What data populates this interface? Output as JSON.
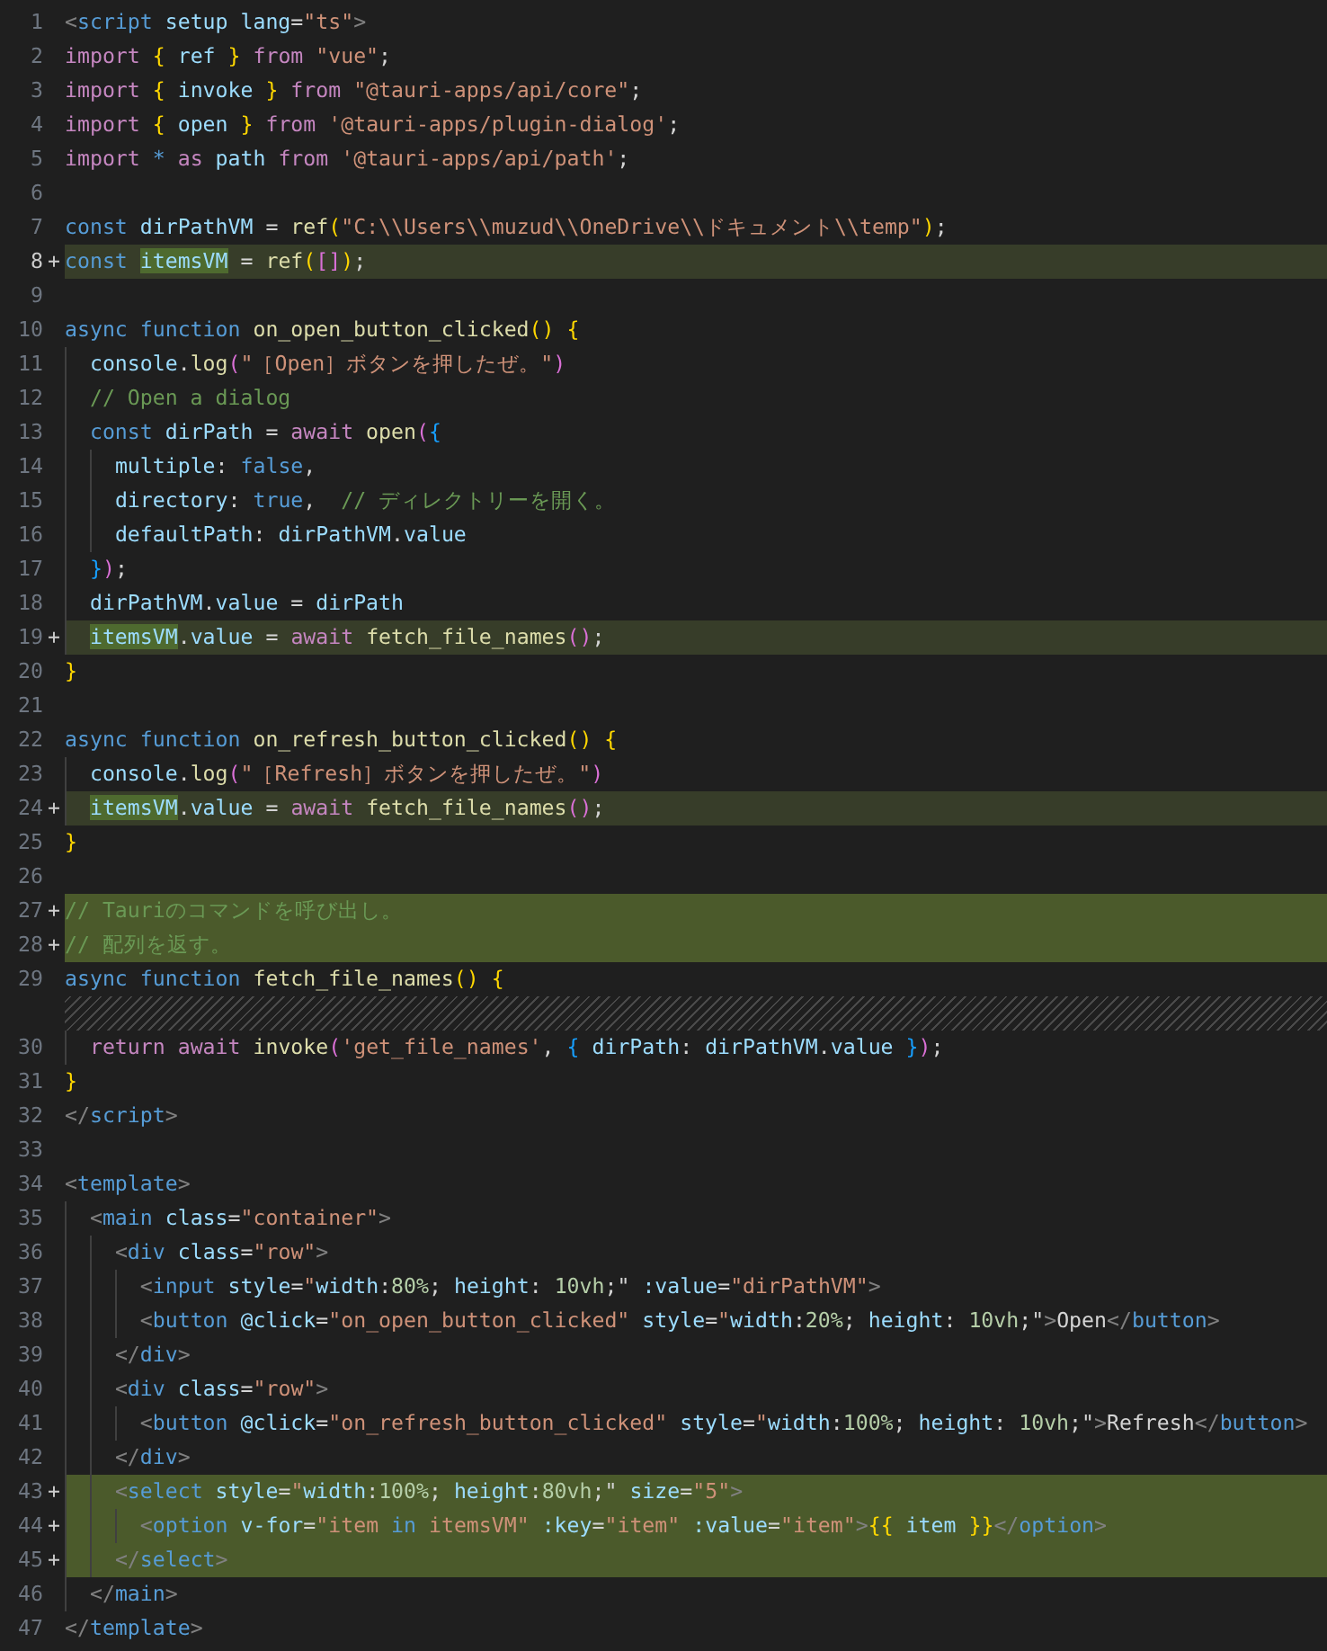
{
  "editor": {
    "lines": [
      {
        "kind": "context",
        "number": "1",
        "current": false,
        "tokens": [
          {
            "text": "<",
            "kind": "tagpunct"
          },
          {
            "text": "script",
            "kind": "tag"
          },
          {
            "text": " setup lang",
            "kind": "attribute"
          },
          {
            "text": "=",
            "kind": "plain"
          },
          {
            "text": "\"ts\"",
            "kind": "string"
          },
          {
            "text": ">",
            "kind": "tagpunct"
          }
        ]
      },
      {
        "kind": "context",
        "number": "2",
        "current": false,
        "tokens": [
          {
            "text": "import ",
            "kind": "keyword"
          },
          {
            "text": "{",
            "kind": "bracket1"
          },
          {
            "text": " ref ",
            "kind": "variable"
          },
          {
            "text": "}",
            "kind": "bracket1"
          },
          {
            "text": " from ",
            "kind": "keyword"
          },
          {
            "text": "\"vue\"",
            "kind": "string"
          },
          {
            "text": ";",
            "kind": "plain"
          }
        ]
      },
      {
        "kind": "context",
        "number": "3",
        "current": false,
        "tokens": [
          {
            "text": "import ",
            "kind": "keyword"
          },
          {
            "text": "{",
            "kind": "bracket1"
          },
          {
            "text": " invoke ",
            "kind": "variable"
          },
          {
            "text": "}",
            "kind": "bracket1"
          },
          {
            "text": " from ",
            "kind": "keyword"
          },
          {
            "text": "\"@tauri-apps/api/core\"",
            "kind": "string"
          },
          {
            "text": ";",
            "kind": "plain"
          }
        ]
      },
      {
        "kind": "context",
        "number": "4",
        "current": false,
        "tokens": [
          {
            "text": "import ",
            "kind": "keyword"
          },
          {
            "text": "{",
            "kind": "bracket1"
          },
          {
            "text": " open ",
            "kind": "variable"
          },
          {
            "text": "}",
            "kind": "bracket1"
          },
          {
            "text": " from ",
            "kind": "keyword"
          },
          {
            "text": "'@tauri-apps/plugin-dialog'",
            "kind": "string"
          },
          {
            "text": ";",
            "kind": "plain"
          }
        ]
      },
      {
        "kind": "context",
        "number": "5",
        "current": false,
        "tokens": [
          {
            "text": "import ",
            "kind": "keyword"
          },
          {
            "text": "*",
            "kind": "storage"
          },
          {
            "text": " as",
            "kind": "keyword"
          },
          {
            "text": " path",
            "kind": "variable"
          },
          {
            "text": " from ",
            "kind": "keyword"
          },
          {
            "text": "'@tauri-apps/api/path'",
            "kind": "string"
          },
          {
            "text": ";",
            "kind": "plain"
          }
        ]
      },
      {
        "kind": "context",
        "number": "6",
        "current": false
      },
      {
        "kind": "context",
        "number": "7",
        "current": false,
        "tokens": [
          {
            "text": "const",
            "kind": "storage"
          },
          {
            "text": " dirPathVM",
            "kind": "variable"
          },
          {
            "text": " = ",
            "kind": "plain"
          },
          {
            "text": "ref",
            "kind": "function"
          },
          {
            "text": "(",
            "kind": "bracket1"
          },
          {
            "text": "\"C:\\\\Users\\\\muzud\\\\OneDrive\\\\ドキュメント\\\\temp\"",
            "kind": "string"
          },
          {
            "text": ")",
            "kind": "bracket1"
          },
          {
            "text": ";",
            "kind": "plain"
          }
        ]
      },
      {
        "kind": "modified",
        "number": "8",
        "marker": "+",
        "current": true,
        "tokens": [
          {
            "text": "const ",
            "kind": "storage"
          },
          {
            "text": "itemsVM",
            "kind": "variable",
            "changed": true
          },
          {
            "text": " = ",
            "kind": "plain"
          },
          {
            "text": "ref",
            "kind": "function"
          },
          {
            "text": "(",
            "kind": "bracket1"
          },
          {
            "text": "[]",
            "kind": "bracket2"
          },
          {
            "text": ")",
            "kind": "bracket1"
          },
          {
            "text": ";",
            "kind": "plain"
          }
        ]
      },
      {
        "kind": "context",
        "number": "9",
        "current": false
      },
      {
        "kind": "context",
        "number": "10",
        "current": false,
        "tokens": [
          {
            "text": "async",
            "kind": "storage"
          },
          {
            "text": " function",
            "kind": "storage"
          },
          {
            "text": " on_open_button_clicked",
            "kind": "function"
          },
          {
            "text": "() ",
            "kind": "bracket1"
          },
          {
            "text": "{",
            "kind": "bracket1"
          }
        ]
      },
      {
        "kind": "context",
        "number": "11",
        "current": false,
        "tokens": [
          {
            "text": "  console",
            "kind": "variable"
          },
          {
            "text": ".",
            "kind": "plain"
          },
          {
            "text": "log",
            "kind": "function"
          },
          {
            "text": "(",
            "kind": "bracket2"
          },
          {
            "text": "\"［Open］ボタンを押したぜ。\"",
            "kind": "string"
          },
          {
            "text": ")",
            "kind": "bracket2"
          }
        ]
      },
      {
        "kind": "context",
        "number": "12",
        "current": false,
        "tokens": [
          {
            "text": "  // Open a dialog",
            "kind": "comment"
          }
        ]
      },
      {
        "kind": "context",
        "number": "13",
        "current": false,
        "tokens": [
          {
            "text": "  const",
            "kind": "storage"
          },
          {
            "text": " dirPath",
            "kind": "variable"
          },
          {
            "text": " = ",
            "kind": "plain"
          },
          {
            "text": "await",
            "kind": "keyword"
          },
          {
            "text": " open",
            "kind": "function"
          },
          {
            "text": "(",
            "kind": "bracket2"
          },
          {
            "text": "{",
            "kind": "bracket3"
          }
        ]
      },
      {
        "kind": "context",
        "number": "14",
        "current": false,
        "tokens": [
          {
            "text": "    multiple",
            "kind": "variable"
          },
          {
            "text": ": ",
            "kind": "plain"
          },
          {
            "text": "false",
            "kind": "storage"
          },
          {
            "text": ",",
            "kind": "plain"
          }
        ]
      },
      {
        "kind": "context",
        "number": "15",
        "current": false,
        "tokens": [
          {
            "text": "    directory",
            "kind": "variable"
          },
          {
            "text": ": ",
            "kind": "plain"
          },
          {
            "text": "true",
            "kind": "storage"
          },
          {
            "text": ",  ",
            "kind": "plain"
          },
          {
            "text": "// ディレクトリーを開く。",
            "kind": "comment"
          }
        ]
      },
      {
        "kind": "context",
        "number": "16",
        "current": false,
        "tokens": [
          {
            "text": "    defaultPath",
            "kind": "variable"
          },
          {
            "text": ": ",
            "kind": "plain"
          },
          {
            "text": "dirPathVM",
            "kind": "variable"
          },
          {
            "text": ".",
            "kind": "plain"
          },
          {
            "text": "value",
            "kind": "variable"
          }
        ]
      },
      {
        "kind": "context",
        "number": "17",
        "current": false,
        "tokens": [
          {
            "text": "  }",
            "kind": "bracket3"
          },
          {
            "text": ")",
            "kind": "bracket2"
          },
          {
            "text": ";",
            "kind": "plain"
          }
        ]
      },
      {
        "kind": "context",
        "number": "18",
        "current": false,
        "tokens": [
          {
            "text": "  dirPathVM",
            "kind": "variable"
          },
          {
            "text": ".",
            "kind": "plain"
          },
          {
            "text": "value",
            "kind": "variable"
          },
          {
            "text": " = ",
            "kind": "plain"
          },
          {
            "text": "dirPath",
            "kind": "variable"
          }
        ]
      },
      {
        "kind": "modified",
        "number": "19",
        "marker": "+",
        "current": false,
        "tokens": [
          {
            "text": "  itemsVM",
            "kind": "variable",
            "changed": true
          },
          {
            "text": ".",
            "kind": "plain"
          },
          {
            "text": "value",
            "kind": "variable"
          },
          {
            "text": " = ",
            "kind": "plain"
          },
          {
            "text": "await",
            "kind": "keyword"
          },
          {
            "text": " fetch_file_names",
            "kind": "function"
          },
          {
            "text": "()",
            "kind": "bracket2"
          },
          {
            "text": ";",
            "kind": "plain"
          }
        ]
      },
      {
        "kind": "context",
        "number": "20",
        "current": false,
        "tokens": [
          {
            "text": "}",
            "kind": "bracket1"
          }
        ]
      },
      {
        "kind": "context",
        "number": "21",
        "current": false
      },
      {
        "kind": "context",
        "number": "22",
        "current": false,
        "tokens": [
          {
            "text": "async",
            "kind": "storage"
          },
          {
            "text": " function",
            "kind": "storage"
          },
          {
            "text": " on_refresh_button_clicked",
            "kind": "function"
          },
          {
            "text": "() ",
            "kind": "bracket1"
          },
          {
            "text": "{",
            "kind": "bracket1"
          }
        ]
      },
      {
        "kind": "context",
        "number": "23",
        "current": false,
        "tokens": [
          {
            "text": "  console",
            "kind": "variable"
          },
          {
            "text": ".",
            "kind": "plain"
          },
          {
            "text": "log",
            "kind": "function"
          },
          {
            "text": "(",
            "kind": "bracket2"
          },
          {
            "text": "\"［Refresh］ボタンを押したぜ。\"",
            "kind": "string"
          },
          {
            "text": ")",
            "kind": "bracket2"
          }
        ]
      },
      {
        "kind": "modified",
        "number": "24",
        "marker": "+",
        "current": false,
        "tokens": [
          {
            "text": "  itemsVM",
            "kind": "variable",
            "changed": true
          },
          {
            "text": ".",
            "kind": "plain"
          },
          {
            "text": "value",
            "kind": "variable"
          },
          {
            "text": " = ",
            "kind": "plain"
          },
          {
            "text": "await",
            "kind": "keyword"
          },
          {
            "text": " fetch_file_names",
            "kind": "function"
          },
          {
            "text": "()",
            "kind": "bracket2"
          },
          {
            "text": ";",
            "kind": "plain"
          }
        ]
      },
      {
        "kind": "context",
        "number": "25",
        "current": false,
        "tokens": [
          {
            "text": "}",
            "kind": "bracket1"
          }
        ]
      },
      {
        "kind": "context",
        "number": "26",
        "current": false
      },
      {
        "kind": "added",
        "number": "27",
        "marker": "+",
        "current": false,
        "tokens": [
          {
            "text": "// Tauriのコマンドを呼び出し。",
            "kind": "comment"
          }
        ]
      },
      {
        "kind": "added",
        "number": "28",
        "marker": "+",
        "current": false,
        "tokens": [
          {
            "text": "// 配列を返す。",
            "kind": "comment"
          }
        ]
      },
      {
        "kind": "context",
        "number": "29",
        "current": false,
        "tokens": [
          {
            "text": "async",
            "kind": "storage"
          },
          {
            "text": " function",
            "kind": "storage"
          },
          {
            "text": " fetch_file_names",
            "kind": "function"
          },
          {
            "text": "() ",
            "kind": "bracket1"
          },
          {
            "text": "{",
            "kind": "bracket1"
          }
        ]
      },
      {
        "kind": "spacer"
      },
      {
        "kind": "context",
        "number": "30",
        "current": false,
        "tokens": [
          {
            "text": "  return",
            "kind": "keyword"
          },
          {
            "text": " await",
            "kind": "keyword"
          },
          {
            "text": " invoke",
            "kind": "function"
          },
          {
            "text": "(",
            "kind": "bracket2"
          },
          {
            "text": "'get_file_names'",
            "kind": "string"
          },
          {
            "text": ", ",
            "kind": "plain"
          },
          {
            "text": "{",
            "kind": "bracket3"
          },
          {
            "text": " dirPath",
            "kind": "variable"
          },
          {
            "text": ": ",
            "kind": "plain"
          },
          {
            "text": "dirPathVM",
            "kind": "variable"
          },
          {
            "text": ".",
            "kind": "plain"
          },
          {
            "text": "value ",
            "kind": "variable"
          },
          {
            "text": "}",
            "kind": "bracket3"
          },
          {
            "text": ")",
            "kind": "bracket2"
          },
          {
            "text": ";",
            "kind": "plain"
          }
        ]
      },
      {
        "kind": "context",
        "number": "31",
        "current": false,
        "tokens": [
          {
            "text": "}",
            "kind": "bracket1"
          }
        ]
      },
      {
        "kind": "context",
        "number": "32",
        "current": false,
        "tokens": [
          {
            "text": "</",
            "kind": "tagpunct"
          },
          {
            "text": "script",
            "kind": "tag"
          },
          {
            "text": ">",
            "kind": "tagpunct"
          }
        ]
      },
      {
        "kind": "context",
        "number": "33",
        "current": false
      },
      {
        "kind": "context",
        "number": "34",
        "current": false,
        "tokens": [
          {
            "text": "<",
            "kind": "tagpunct"
          },
          {
            "text": "template",
            "kind": "tag"
          },
          {
            "text": ">",
            "kind": "tagpunct"
          }
        ]
      },
      {
        "kind": "context",
        "number": "35",
        "current": false,
        "tokens": [
          {
            "text": "  <",
            "kind": "tagpunct"
          },
          {
            "text": "main",
            "kind": "tag"
          },
          {
            "text": " class",
            "kind": "attribute"
          },
          {
            "text": "=",
            "kind": "plain"
          },
          {
            "text": "\"container\"",
            "kind": "string"
          },
          {
            "text": ">",
            "kind": "tagpunct"
          }
        ]
      },
      {
        "kind": "context",
        "number": "36",
        "current": false,
        "tokens": [
          {
            "text": "    <",
            "kind": "tagpunct"
          },
          {
            "text": "div",
            "kind": "tag"
          },
          {
            "text": " class",
            "kind": "attribute"
          },
          {
            "text": "=",
            "kind": "plain"
          },
          {
            "text": "\"row\"",
            "kind": "string"
          },
          {
            "text": ">",
            "kind": "tagpunct"
          }
        ]
      },
      {
        "kind": "context",
        "number": "37",
        "current": false,
        "tokens": [
          {
            "text": "      <",
            "kind": "tagpunct"
          },
          {
            "text": "input",
            "kind": "tag"
          },
          {
            "text": " style",
            "kind": "attribute"
          },
          {
            "text": "=",
            "kind": "plain"
          },
          {
            "text": "\"",
            "kind": "string"
          },
          {
            "text": "width",
            "kind": "attribute"
          },
          {
            "text": ":",
            "kind": "plain"
          },
          {
            "text": "80%",
            "kind": "number"
          },
          {
            "text": "; ",
            "kind": "plain"
          },
          {
            "text": "height",
            "kind": "attribute"
          },
          {
            "text": ": ",
            "kind": "plain"
          },
          {
            "text": "10vh",
            "kind": "number"
          },
          {
            "text": ";\"",
            "kind": "plain"
          },
          {
            "text": " :value",
            "kind": "attribute"
          },
          {
            "text": "=",
            "kind": "plain"
          },
          {
            "text": "\"dirPathVM\"",
            "kind": "string"
          },
          {
            "text": ">",
            "kind": "tagpunct"
          }
        ]
      },
      {
        "kind": "context",
        "number": "38",
        "current": false,
        "tokens": [
          {
            "text": "      <",
            "kind": "tagpunct"
          },
          {
            "text": "button",
            "kind": "tag"
          },
          {
            "text": " @click",
            "kind": "attribute"
          },
          {
            "text": "=",
            "kind": "plain"
          },
          {
            "text": "\"on_open_button_clicked\"",
            "kind": "string"
          },
          {
            "text": " style",
            "kind": "attribute"
          },
          {
            "text": "=",
            "kind": "plain"
          },
          {
            "text": "\"",
            "kind": "string"
          },
          {
            "text": "width",
            "kind": "attribute"
          },
          {
            "text": ":",
            "kind": "plain"
          },
          {
            "text": "20%",
            "kind": "number"
          },
          {
            "text": "; ",
            "kind": "plain"
          },
          {
            "text": "height",
            "kind": "attribute"
          },
          {
            "text": ": ",
            "kind": "plain"
          },
          {
            "text": "10vh",
            "kind": "number"
          },
          {
            "text": ";\"",
            "kind": "plain"
          },
          {
            "text": ">",
            "kind": "tagpunct"
          },
          {
            "text": "Open",
            "kind": "plain"
          },
          {
            "text": "</",
            "kind": "tagpunct"
          },
          {
            "text": "button",
            "kind": "tag"
          },
          {
            "text": ">",
            "kind": "tagpunct"
          }
        ]
      },
      {
        "kind": "context",
        "number": "39",
        "current": false,
        "tokens": [
          {
            "text": "    </",
            "kind": "tagpunct"
          },
          {
            "text": "div",
            "kind": "tag"
          },
          {
            "text": ">",
            "kind": "tagpunct"
          }
        ]
      },
      {
        "kind": "context",
        "number": "40",
        "current": false,
        "tokens": [
          {
            "text": "    <",
            "kind": "tagpunct"
          },
          {
            "text": "div",
            "kind": "tag"
          },
          {
            "text": " class",
            "kind": "attribute"
          },
          {
            "text": "=",
            "kind": "plain"
          },
          {
            "text": "\"row\"",
            "kind": "string"
          },
          {
            "text": ">",
            "kind": "tagpunct"
          }
        ]
      },
      {
        "kind": "context",
        "number": "41",
        "current": false,
        "tokens": [
          {
            "text": "      <",
            "kind": "tagpunct"
          },
          {
            "text": "button",
            "kind": "tag"
          },
          {
            "text": " @click",
            "kind": "attribute"
          },
          {
            "text": "=",
            "kind": "plain"
          },
          {
            "text": "\"on_refresh_button_clicked\"",
            "kind": "string"
          },
          {
            "text": " style",
            "kind": "attribute"
          },
          {
            "text": "=",
            "kind": "plain"
          },
          {
            "text": "\"",
            "kind": "string"
          },
          {
            "text": "width",
            "kind": "attribute"
          },
          {
            "text": ":",
            "kind": "plain"
          },
          {
            "text": "100%",
            "kind": "number"
          },
          {
            "text": "; ",
            "kind": "plain"
          },
          {
            "text": "height",
            "kind": "attribute"
          },
          {
            "text": ": ",
            "kind": "plain"
          },
          {
            "text": "10vh",
            "kind": "number"
          },
          {
            "text": ";\"",
            "kind": "plain"
          },
          {
            "text": ">",
            "kind": "tagpunct"
          },
          {
            "text": "Refresh",
            "kind": "plain"
          },
          {
            "text": "</",
            "kind": "tagpunct"
          },
          {
            "text": "button",
            "kind": "tag"
          },
          {
            "text": ">",
            "kind": "tagpunct"
          }
        ]
      },
      {
        "kind": "context",
        "number": "42",
        "current": false,
        "tokens": [
          {
            "text": "    </",
            "kind": "tagpunct"
          },
          {
            "text": "div",
            "kind": "tag"
          },
          {
            "text": ">",
            "kind": "tagpunct"
          }
        ]
      },
      {
        "kind": "added",
        "number": "43",
        "marker": "+",
        "current": false,
        "tokens": [
          {
            "text": "    <",
            "kind": "tagpunct"
          },
          {
            "text": "select",
            "kind": "tag"
          },
          {
            "text": " style",
            "kind": "attribute"
          },
          {
            "text": "=",
            "kind": "plain"
          },
          {
            "text": "\"",
            "kind": "string"
          },
          {
            "text": "width",
            "kind": "attribute"
          },
          {
            "text": ":",
            "kind": "plain"
          },
          {
            "text": "100%",
            "kind": "number"
          },
          {
            "text": "; ",
            "kind": "plain"
          },
          {
            "text": "height",
            "kind": "attribute"
          },
          {
            "text": ":",
            "kind": "plain"
          },
          {
            "text": "80vh",
            "kind": "number"
          },
          {
            "text": ";\"",
            "kind": "plain"
          },
          {
            "text": " size",
            "kind": "attribute"
          },
          {
            "text": "=",
            "kind": "plain"
          },
          {
            "text": "\"5\"",
            "kind": "string"
          },
          {
            "text": ">",
            "kind": "tagpunct"
          }
        ]
      },
      {
        "kind": "added",
        "number": "44",
        "marker": "+",
        "current": false,
        "tokens": [
          {
            "text": "      <",
            "kind": "tagpunct"
          },
          {
            "text": "option",
            "kind": "tag"
          },
          {
            "text": " v-for",
            "kind": "attribute"
          },
          {
            "text": "=",
            "kind": "plain"
          },
          {
            "text": "\"item",
            "kind": "string"
          },
          {
            "text": " in",
            "kind": "storage"
          },
          {
            "text": " itemsVM\"",
            "kind": "string"
          },
          {
            "text": " :key",
            "kind": "attribute"
          },
          {
            "text": "=",
            "kind": "plain"
          },
          {
            "text": "\"item\"",
            "kind": "string"
          },
          {
            "text": " :value",
            "kind": "attribute"
          },
          {
            "text": "=",
            "kind": "plain"
          },
          {
            "text": "\"item\"",
            "kind": "string"
          },
          {
            "text": ">",
            "kind": "tagpunct"
          },
          {
            "text": "{{",
            "kind": "bracket1"
          },
          {
            "text": " item ",
            "kind": "variable"
          },
          {
            "text": "}}",
            "kind": "bracket1"
          },
          {
            "text": "</",
            "kind": "tagpunct"
          },
          {
            "text": "option",
            "kind": "tag"
          },
          {
            "text": ">",
            "kind": "tagpunct"
          }
        ]
      },
      {
        "kind": "added",
        "number": "45",
        "marker": "+",
        "current": false,
        "tokens": [
          {
            "text": "    </",
            "kind": "tagpunct"
          },
          {
            "text": "select",
            "kind": "tag"
          },
          {
            "text": ">",
            "kind": "tagpunct"
          }
        ]
      },
      {
        "kind": "context",
        "number": "46",
        "current": false,
        "tokens": [
          {
            "text": "  </",
            "kind": "tagpunct"
          },
          {
            "text": "main",
            "kind": "tag"
          },
          {
            "text": ">",
            "kind": "tagpunct"
          }
        ]
      },
      {
        "kind": "context",
        "number": "47",
        "current": false,
        "tokens": [
          {
            "text": "</",
            "kind": "tagpunct"
          },
          {
            "text": "template",
            "kind": "tag"
          },
          {
            "text": ">",
            "kind": "tagpunct"
          }
        ]
      }
    ]
  }
}
